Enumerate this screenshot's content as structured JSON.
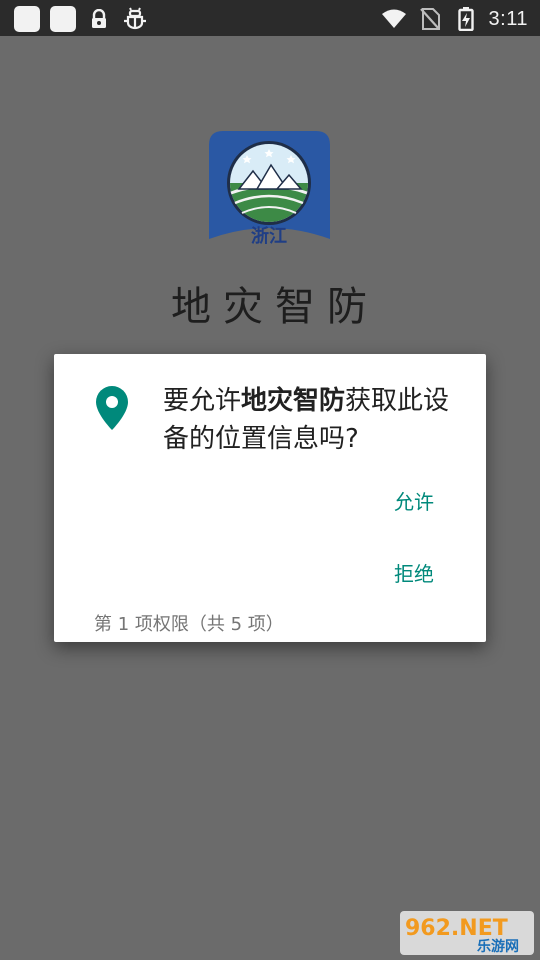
{
  "status_bar": {
    "time": "3:11",
    "icons": [
      "notification-square-icon",
      "notification-square-icon",
      "lock-icon",
      "bug-icon",
      "wifi-icon",
      "no-sim-icon",
      "battery-charging-icon"
    ]
  },
  "app": {
    "name": "地灾智防",
    "logo_text": "浙江"
  },
  "dialog": {
    "message_prefix": "要允许",
    "message_app": "地灾智防",
    "message_suffix": "获取此设备的位置信息吗?",
    "allow_label": "允许",
    "deny_label": "拒绝",
    "footer": "第 1 项权限（共 5 项）",
    "accent_color": "#00897b",
    "icon": "location-pin-icon"
  },
  "watermark": {
    "text_main": "962.NET",
    "text_sub": "乐游网"
  }
}
